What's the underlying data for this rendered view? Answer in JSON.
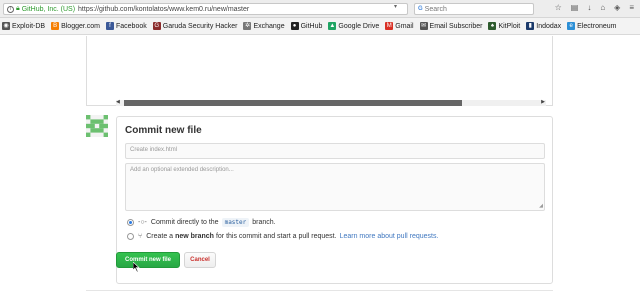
{
  "browser": {
    "site_identity": "GitHub, Inc. (US)",
    "url": "https://github.com/kontolatos/www.kem0.ru/new/master",
    "search_placeholder": "Search",
    "search_engine_icon": "search-engine-icon"
  },
  "bookmarks": [
    {
      "label": "Exploit-DB",
      "icon": "bug-icon",
      "color": "#555555",
      "glyph": "◉"
    },
    {
      "label": "Blogger.com",
      "icon": "blogger-icon",
      "color": "#f57d00",
      "glyph": "B"
    },
    {
      "label": "Facebook",
      "icon": "facebook-icon",
      "color": "#3b5998",
      "glyph": "f"
    },
    {
      "label": "Garuda Security Hacker",
      "icon": "garuda-icon",
      "color": "#8b2c2c",
      "glyph": "G"
    },
    {
      "label": "Exchange",
      "icon": "gear-icon",
      "color": "#777777",
      "glyph": "✲"
    },
    {
      "label": "GitHub",
      "icon": "github-icon",
      "color": "#222222",
      "glyph": "●"
    },
    {
      "label": "Google Drive",
      "icon": "google-drive-icon",
      "color": "#1fa463",
      "glyph": "▲"
    },
    {
      "label": "Gmail",
      "icon": "gmail-icon",
      "color": "#d93025",
      "glyph": "M"
    },
    {
      "label": "Email Subscriber",
      "icon": "email-icon",
      "color": "#555555",
      "glyph": "✉"
    },
    {
      "label": "KitPloit",
      "icon": "kitploit-icon",
      "color": "#2d5a2d",
      "glyph": "♠"
    },
    {
      "label": "Indodax",
      "icon": "indodax-icon",
      "color": "#1b3a6b",
      "glyph": "▮"
    },
    {
      "label": "Electroneum",
      "icon": "electroneum-icon",
      "color": "#2c8fd6",
      "glyph": "e"
    }
  ],
  "commit": {
    "title": "Commit new file",
    "filename_placeholder": "Create index.html",
    "description_placeholder": "Add an optional extended description...",
    "option1_prefix": "Commit directly to the",
    "branch": "master",
    "option1_suffix": "branch.",
    "option2_prefix": "Create a",
    "option2_bold": "new branch",
    "option2_suffix": "for this commit and start a pull request.",
    "option2_link": "Learn more about pull requests.",
    "selected_option": 1
  },
  "buttons": {
    "commit_label": "Commit new file",
    "cancel_label": "Cancel"
  },
  "colors": {
    "commit_button": "#28a745",
    "cancel_text": "#c9302c",
    "link": "#4078c0"
  }
}
